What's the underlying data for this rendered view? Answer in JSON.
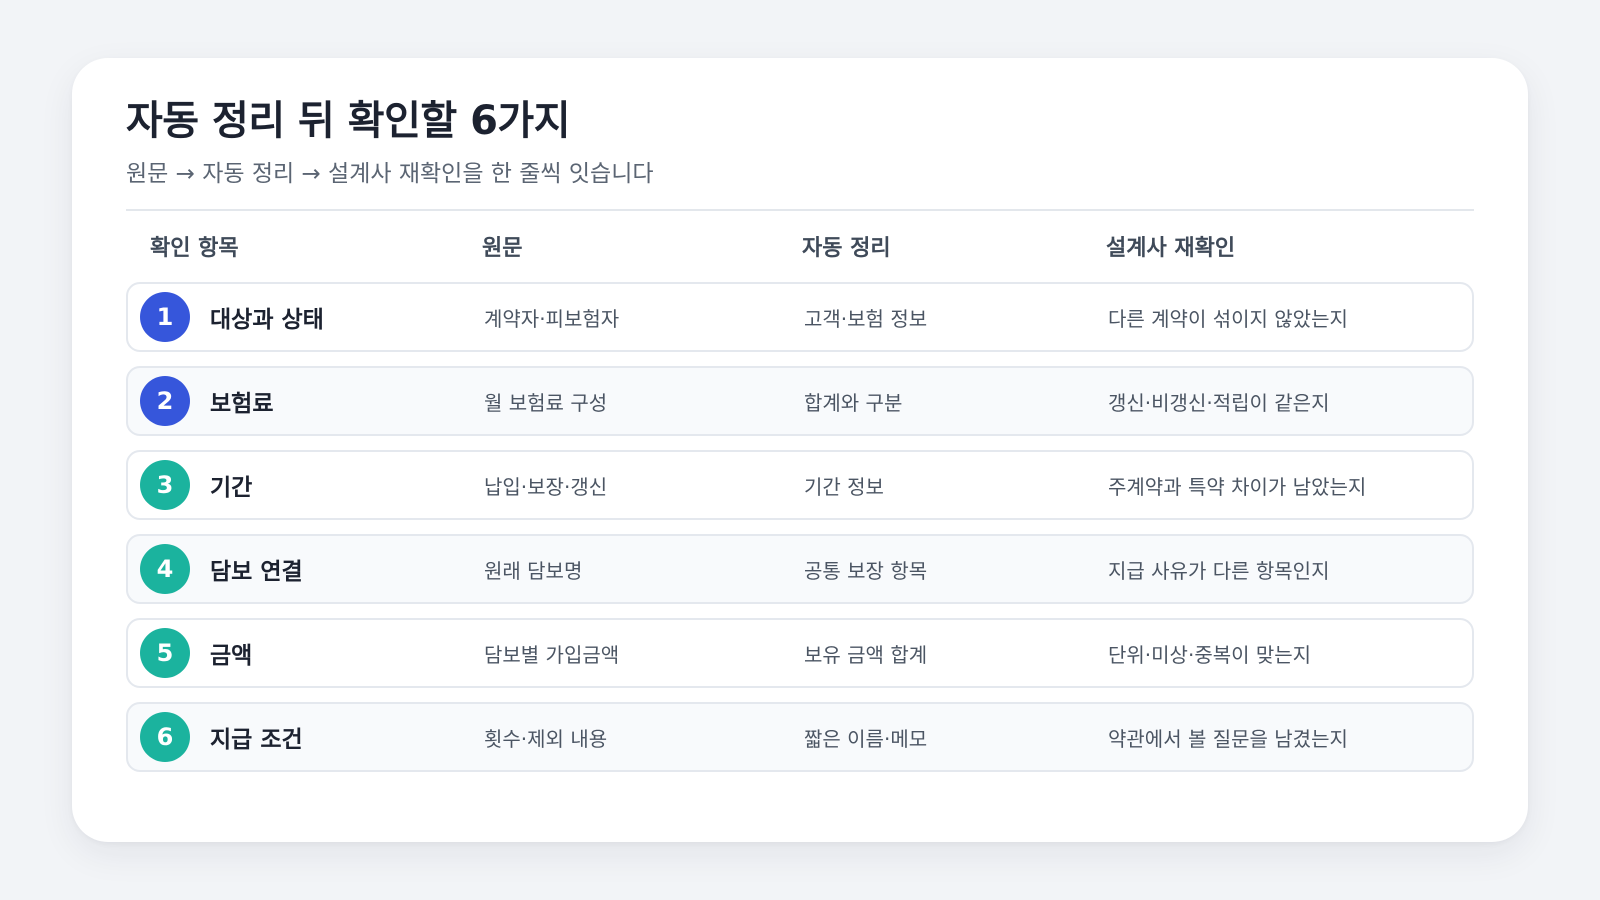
{
  "title": "자동 정리 뒤 확인할 6가지",
  "subtitle": "원문 → 자동 정리 → 설계사 재확인을 한 줄씩 잇습니다",
  "columns": [
    "확인 항목",
    "원문",
    "자동 정리",
    "설계사 재확인"
  ],
  "colors": {
    "badge_blue": "#3656db",
    "badge_teal": "#1bb39e"
  },
  "rows": [
    {
      "number": "1",
      "item": "대상과 상태",
      "source": "계약자·피보험자",
      "auto": "고객·보험 정보",
      "recheck": "다른 계약이 섞이지 않았는지",
      "badge_color": "#3656db"
    },
    {
      "number": "2",
      "item": "보험료",
      "source": "월 보험료 구성",
      "auto": "합계와 구분",
      "recheck": "갱신·비갱신·적립이 같은지",
      "badge_color": "#3656db"
    },
    {
      "number": "3",
      "item": "기간",
      "source": "납입·보장·갱신",
      "auto": "기간 정보",
      "recheck": "주계약과 특약 차이가 남았는지",
      "badge_color": "#1bb39e"
    },
    {
      "number": "4",
      "item": "담보 연결",
      "source": "원래 담보명",
      "auto": "공통 보장 항목",
      "recheck": "지급 사유가 다른 항목인지",
      "badge_color": "#1bb39e"
    },
    {
      "number": "5",
      "item": "금액",
      "source": "담보별 가입금액",
      "auto": "보유 금액 합계",
      "recheck": "단위·미상·중복이 맞는지",
      "badge_color": "#1bb39e"
    },
    {
      "number": "6",
      "item": "지급 조건",
      "source": "횟수·제외 내용",
      "auto": "짧은 이름·메모",
      "recheck": "약관에서 볼 질문을 남겼는지",
      "badge_color": "#1bb39e"
    }
  ]
}
